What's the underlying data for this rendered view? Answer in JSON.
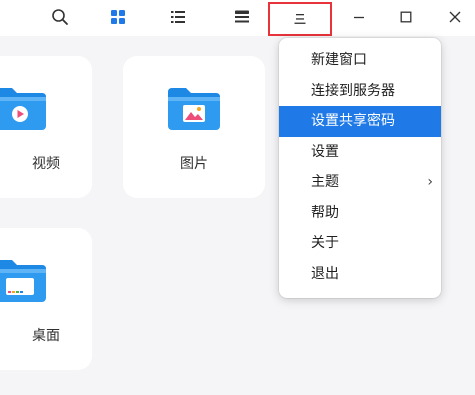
{
  "toolbar": {
    "search_icon": "search-icon",
    "grid_view_icon": "grid-view-icon",
    "list_view_icon": "list-view-icon",
    "details_icon": "details-view-icon",
    "menu_icon": "hamburger-menu-icon",
    "minimize_icon": "minimize-icon",
    "maximize_icon": "maximize-icon",
    "close_icon": "close-icon",
    "accent_color": "#1f7ae8",
    "highlight_border_color": "#e8333b"
  },
  "items": [
    {
      "label": "视频",
      "icon": "video-folder-icon"
    },
    {
      "label": "图片",
      "icon": "pictures-folder-icon"
    },
    {
      "label": "桌面",
      "icon": "desktop-folder-icon"
    }
  ],
  "menu": {
    "items": [
      {
        "label": "新建窗口",
        "active": false,
        "submenu": false
      },
      {
        "label": "连接到服务器",
        "active": false,
        "submenu": false
      },
      {
        "label": "设置共享密码",
        "active": true,
        "submenu": false
      },
      {
        "label": "设置",
        "active": false,
        "submenu": false
      },
      {
        "label": "主题",
        "active": false,
        "submenu": true
      },
      {
        "label": "帮助",
        "active": false,
        "submenu": false
      },
      {
        "label": "关于",
        "active": false,
        "submenu": false
      },
      {
        "label": "退出",
        "active": false,
        "submenu": false
      }
    ],
    "submenu_arrow": "›",
    "active_color": "#1f7ae8"
  }
}
